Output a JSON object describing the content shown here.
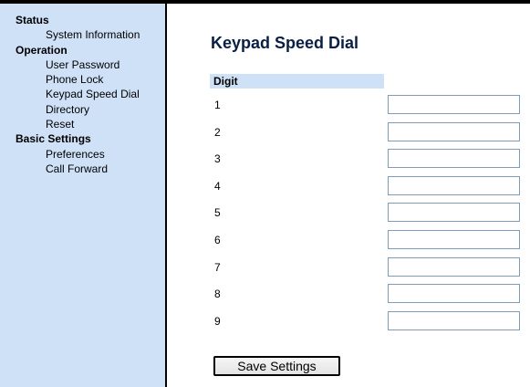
{
  "sidebar": {
    "sections": [
      {
        "label": "Status",
        "items": [
          {
            "label": "System Information"
          }
        ]
      },
      {
        "label": "Operation",
        "items": [
          {
            "label": "User Password"
          },
          {
            "label": "Phone Lock"
          },
          {
            "label": "Keypad Speed Dial"
          },
          {
            "label": "Directory"
          },
          {
            "label": "Reset"
          }
        ]
      },
      {
        "label": "Basic Settings",
        "items": [
          {
            "label": "Preferences"
          },
          {
            "label": "Call Forward"
          }
        ]
      }
    ]
  },
  "main": {
    "title": "Keypad Speed Dial",
    "column_header": "Digit",
    "rows": [
      {
        "digit": "1",
        "value": ""
      },
      {
        "digit": "2",
        "value": ""
      },
      {
        "digit": "3",
        "value": ""
      },
      {
        "digit": "4",
        "value": ""
      },
      {
        "digit": "5",
        "value": ""
      },
      {
        "digit": "6",
        "value": ""
      },
      {
        "digit": "7",
        "value": ""
      },
      {
        "digit": "8",
        "value": ""
      },
      {
        "digit": "9",
        "value": ""
      }
    ],
    "save_label": "Save Settings"
  },
  "colors": {
    "sidebar_bg": "#cfe1f7",
    "header_bg": "#cfe1f7",
    "title_color": "#0a1f44",
    "input_border": "#7f9db9"
  }
}
